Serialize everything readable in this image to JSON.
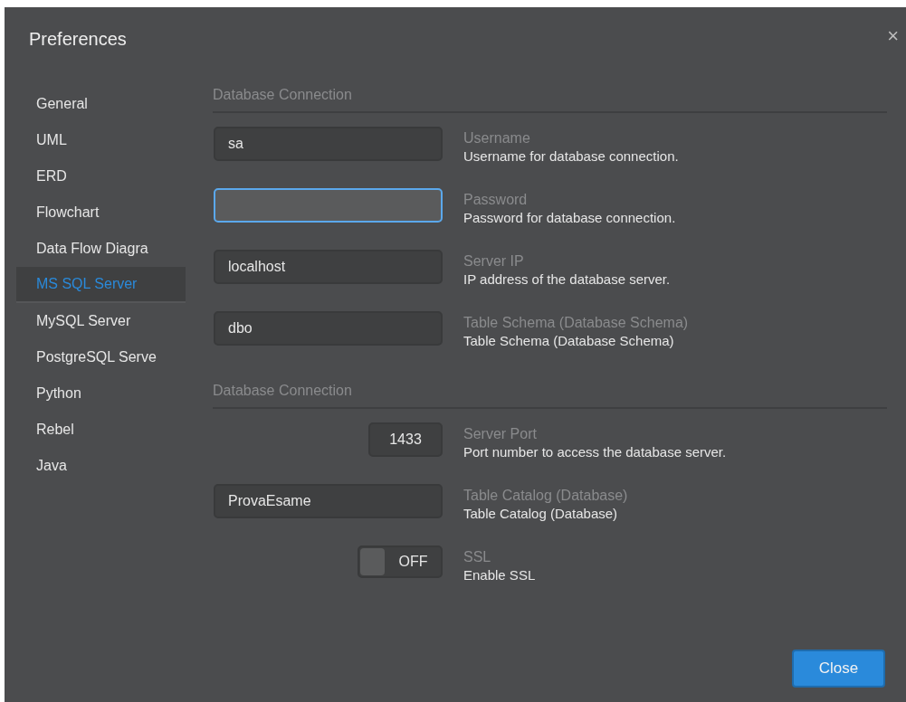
{
  "window": {
    "title": "Preferences",
    "close": "×"
  },
  "sidebar": {
    "items": [
      {
        "label": "General",
        "selected": false
      },
      {
        "label": "UML",
        "selected": false
      },
      {
        "label": "ERD",
        "selected": false
      },
      {
        "label": "Flowchart",
        "selected": false
      },
      {
        "label": "Data Flow Diagra",
        "selected": false
      },
      {
        "label": "MS SQL Server",
        "selected": true
      },
      {
        "label": "MySQL Server",
        "selected": false
      },
      {
        "label": "PostgreSQL Serve",
        "selected": false
      },
      {
        "label": "Python",
        "selected": false
      },
      {
        "label": "Rebel",
        "selected": false
      },
      {
        "label": "Java",
        "selected": false
      }
    ]
  },
  "sections": [
    {
      "heading": "Database Connection",
      "settings": [
        {
          "kind": "text",
          "value": "sa",
          "focused": false,
          "label": "Username",
          "description": "Username for database connection."
        },
        {
          "kind": "text",
          "focused": true,
          "label": "Password",
          "description": "Password for database connection."
        },
        {
          "kind": "text",
          "value": "localhost",
          "focused": false,
          "label": "Server IP",
          "description": "IP address of the database server."
        },
        {
          "kind": "text",
          "value": "dbo",
          "focused": false,
          "label": "Table Schema (Database Schema)",
          "description": "Table Schema (Database Schema)"
        }
      ]
    },
    {
      "heading": "Database Connection",
      "settings": [
        {
          "kind": "number",
          "value": "1433",
          "focused": false,
          "label": "Server Port",
          "description": "Port number to access the database server."
        },
        {
          "kind": "text",
          "value": "ProvaEsame",
          "focused": false,
          "label": "Table Catalog (Database)",
          "description": "Table Catalog (Database)"
        },
        {
          "kind": "toggle",
          "on": false,
          "state_text": "OFF",
          "label": "SSL",
          "description": "Enable SSL"
        }
      ]
    }
  ],
  "buttons": [
    "Close"
  ]
}
